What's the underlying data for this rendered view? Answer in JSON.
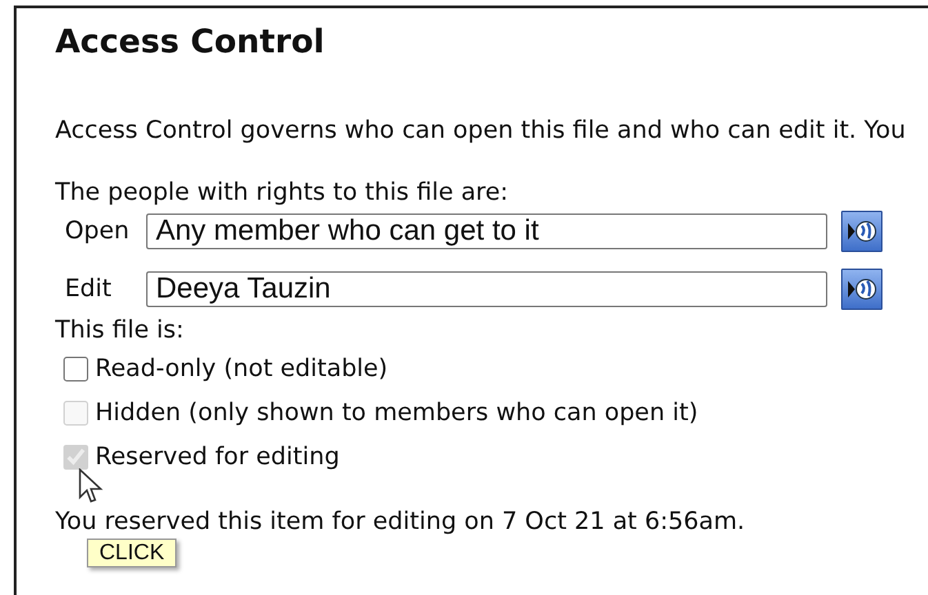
{
  "title": "Access Control",
  "intro": "Access Control governs who can open this file and who can edit it. You",
  "rights_heading": "The people with rights to this file are:",
  "rights": [
    {
      "label": "Open",
      "value": "Any member who can get to it"
    },
    {
      "label": "Edit",
      "value": "Deeya Tauzin"
    }
  ],
  "status_heading": "This file is:",
  "options": [
    {
      "label": "Read-only (not editable)",
      "checked": false,
      "disabled": false
    },
    {
      "label": "Hidden (only shown to members who can open it)",
      "checked": false,
      "disabled": true
    },
    {
      "label": "Reserved for editing",
      "checked": true,
      "disabled": true
    }
  ],
  "note": "You reserved this item for editing on 7 Oct 21 at 6:56am.",
  "tooltip": "CLICK"
}
